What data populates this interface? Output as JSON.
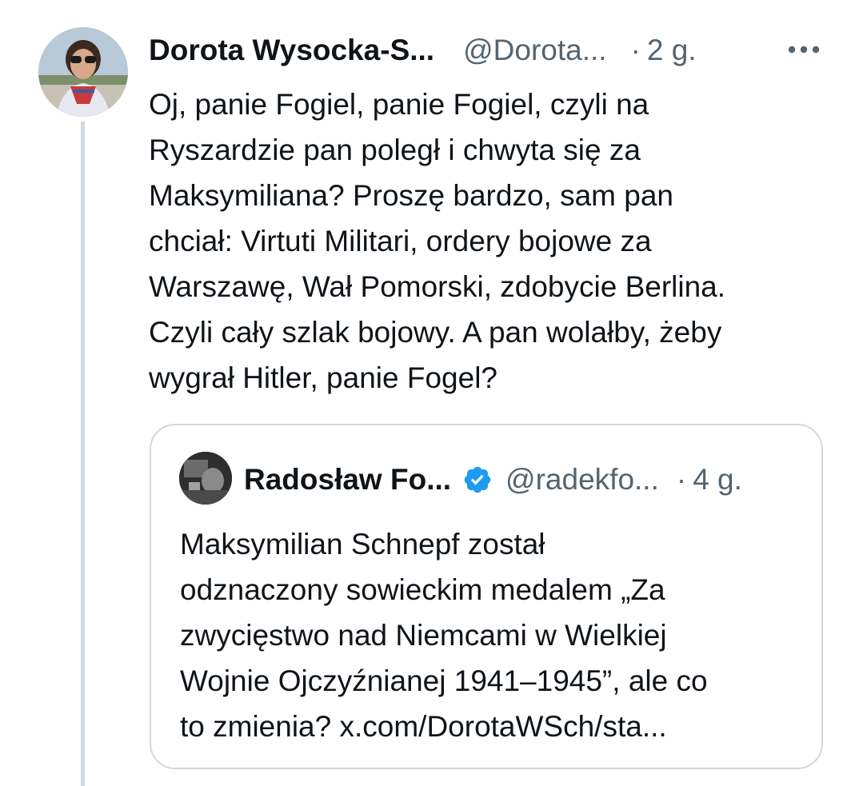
{
  "tweet": {
    "author_name": "Dorota Wysocka-S...",
    "author_handle": "@Dorota...",
    "dot": "·",
    "time": "2 g.",
    "more_icon": "more-horizontal-icon",
    "text": "Oj, panie Fogiel, panie Fogiel, czyli na\nRyszardzie pan poległ i chwyta się za\nMaksymiliana? Proszę bardzo, sam pan\nchciał: Virtuti Militari, ordery bojowe za\nWarszawę, Wał Pomorski, zdobycie Berlina.\nCzyli cały szlak bojowy. A pan wolałby, żeby\nwygrał Hitler, panie Fogel?"
  },
  "quote": {
    "author_name": "Radosław Fo...",
    "verified_icon": "verified-badge-icon",
    "author_handle": "@radekfo...",
    "dot": "·",
    "time": "4 g.",
    "text": "Maksymilian Schnepf został\nodznaczony sowieckim medalem „Za\nzwycięstwo nad Niemcami w Wielkiej\nWojnie Ojczyźnianej 1941–1945”, ale co\nto zmienia? x.com/DorotaWSch/sta..."
  },
  "colors": {
    "text_primary": "#0f1419",
    "text_secondary": "#536471",
    "border": "#cfd9de",
    "verified_blue": "#1d9bf0"
  }
}
